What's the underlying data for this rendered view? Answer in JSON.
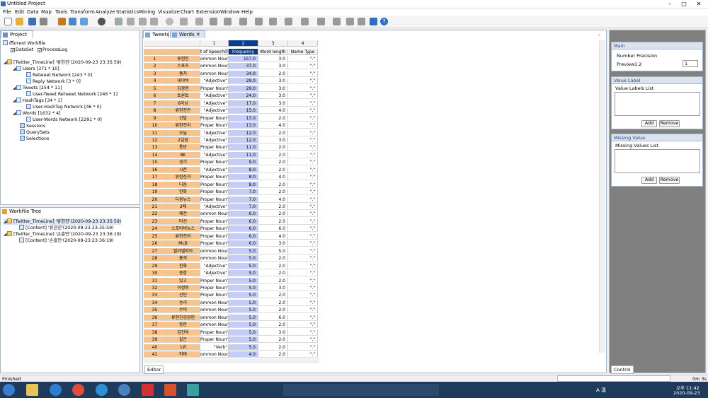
{
  "window": {
    "title": "Untitled Project"
  },
  "menu": [
    "File",
    "Edit",
    "Data",
    "Map",
    "Tools",
    "Transform",
    "Analyze",
    "Statistics",
    "Mining",
    "Visualize",
    "Chart",
    "Extension",
    "Window",
    "Help"
  ],
  "project_panel": {
    "tab": "Project",
    "current_workfile": "Current Workfile",
    "dataset_label": "DataSet",
    "processlog_label": "ProcessLog",
    "tree": [
      "[Twitter_TimeLine] '류현진'(2020-09-23 23:35:59)",
      "Users [371 * 10]",
      "Retweet Network [243 * 0]",
      "Reply Network [3 * 0]",
      "Tweets [254 * 11]",
      "User-Tweet Retweet Network [246 * 1]",
      "HashTags [34 * 1]",
      "User-HashTag Network [46 * 0]",
      "Words [1632 * 4]",
      "User-Words Network [2291 * 0]",
      "Sessions",
      "QuerySets",
      "Selections"
    ]
  },
  "workfile_tree": {
    "tab": "Workfile Tree",
    "items": [
      "[Twitter_TimeLine] '류현진'(2020-09-23 23:35:59)",
      "[Content] '류현진'(2020-09-23 23:35:59)",
      "[Twitter_TimeLine] '손흥민'(2020-09-23 23:36:19)",
      "[Content] '손흥민'(2020-09-23 23:36:19)"
    ]
  },
  "editor": {
    "tabs": [
      "Tweets",
      "Words"
    ],
    "footer": "Editor",
    "col_numbers": [
      "1",
      "2",
      "3",
      "4"
    ],
    "col_headers": [
      "t of Speech(P",
      "Frequency",
      "Word length",
      "Name Type"
    ],
    "rows": [
      [
        "1",
        "류현진",
        "ommon Noun\"",
        "157.0",
        "3.0",
        "\".\""
      ],
      [
        "2",
        "스포츠",
        "ommon Noun\"",
        "37.0",
        "3.0",
        "\".\""
      ],
      [
        "3",
        "홈처",
        "ommon Noun\"",
        "34.0",
        "2.0",
        "\".\""
      ],
      [
        "4",
        "내야비",
        "\"Adjective\"",
        "29.0",
        "3.0",
        "\".\""
      ],
      [
        "5",
        "김광현",
        "Proper Noun\"",
        "29.0",
        "3.0",
        "\".\""
      ],
      [
        "6",
        "토론토",
        "\"Adjective\"",
        "24.0",
        "3.0",
        "\".\""
      ],
      [
        "7",
        "6이닝",
        "\"Adjective\"",
        "17.0",
        "3.0",
        "\".\""
      ],
      [
        "8",
        "류현진은",
        "\"Adjective\"",
        "15.0",
        "4.0",
        "\".\""
      ],
      [
        "9",
        "선발",
        "Proper Noun\"",
        "13.0",
        "2.0",
        "\".\""
      ],
      [
        "10",
        "류현진이",
        "Proper Noun\"",
        "13.0",
        "4.0",
        "\".\""
      ],
      [
        "11",
        "오늘",
        "\"Adjective\"",
        "12.0",
        "2.0",
        "\".\""
      ],
      [
        "12",
        "2실점",
        "\"Adjective\"",
        "12.0",
        "3.0",
        "\".\""
      ],
      [
        "13",
        "통반",
        "Proper Noun\"",
        "11.0",
        "2.0",
        "\".\""
      ],
      [
        "14",
        "8K",
        "\"Adjective\"",
        "11.0",
        "2.0",
        "\".\""
      ],
      [
        "15",
        "경기",
        "Proper Noun\"",
        "9.0",
        "2.0",
        "\".\""
      ],
      [
        "16",
        "시즌",
        "\"Adjective\"",
        "8.0",
        "2.0",
        "\".\""
      ],
      [
        "17",
        "류현진과",
        "Proper Noun\"",
        "8.0",
        "4.0",
        "\".\""
      ],
      [
        "18",
        "다음",
        "Proper Noun\"",
        "8.0",
        "2.0",
        "\".\""
      ],
      [
        "19",
        "한화",
        "Proper Noun\"",
        "7.0",
        "2.0",
        "\".\""
      ],
      [
        "20",
        "다음뉴스",
        "Proper Noun\"",
        "7.0",
        "4.0",
        "\".\""
      ],
      [
        "21",
        "2패",
        "\"Adjective\"",
        "7.0",
        "2.0",
        "\".\""
      ],
      [
        "22",
        "패전",
        "ommon Noun\"",
        "6.0",
        "2.0",
        "\".\""
      ],
      [
        "23",
        "타선",
        "Proper Noun\"",
        "6.0",
        "2.0",
        "\".\""
      ],
      [
        "24",
        "스포티비뉴스",
        "Proper Noun\"",
        "6.0",
        "6.0",
        "\".\""
      ],
      [
        "25",
        "류현진의",
        "Proper Noun\"",
        "6.0",
        "4.0",
        "\".\""
      ],
      [
        "26",
        "MLB",
        "Proper Noun\"",
        "6.0",
        "3.0",
        "\".\""
      ],
      [
        "27",
        "필라델피아",
        "ommon Noun\"",
        "5.0",
        "5.0",
        "\".\""
      ],
      [
        "28",
        "홈격",
        "ommon Noun\"",
        "5.0",
        "2.0",
        "\".\""
      ],
      [
        "29",
        "진화",
        "\"Adjective\"",
        "5.0",
        "2.0",
        "\".\""
      ],
      [
        "30",
        "종합",
        "\"Adjective\"",
        "5.0",
        "2.0",
        "\".\""
      ],
      [
        "31",
        "있고",
        "Proper Noun\"",
        "5.0",
        "2.0",
        "\".\""
      ],
      [
        "32",
        "이정후",
        "Proper Noun\"",
        "5.0",
        "3.0",
        "\".\""
      ],
      [
        "33",
        "선인",
        "Proper Noun\"",
        "5.0",
        "2.0",
        "\".\""
      ],
      [
        "34",
        "승리",
        "ommon Noun\"",
        "5.0",
        "2.0",
        "\".\""
      ],
      [
        "35",
        "수비",
        "ommon Noun\"",
        "5.0",
        "2.0",
        "\".\""
      ],
      [
        "36",
        "류현진김광현",
        "ommon Noun\"",
        "5.0",
        "6.0",
        "\".\""
      ],
      [
        "37",
        "동판",
        "ommon Noun\"",
        "5.0",
        "2.0",
        "\".\""
      ],
      [
        "38",
        "김진욱",
        "Proper Noun\"",
        "5.0",
        "3.0",
        "\".\""
      ],
      [
        "39",
        "같은",
        "Proper Noun\"",
        "5.0",
        "2.0",
        "\".\""
      ],
      [
        "40",
        "1위",
        "\"Verb\"",
        "5.0",
        "2.0",
        "\".\""
      ],
      [
        "41",
        "하며",
        "ommon Noun\"",
        "4.0",
        "2.0",
        "\".\""
      ]
    ]
  },
  "control": {
    "footer": "Control",
    "main": {
      "title": "Main",
      "label": "Number Precision",
      "preview_label": "Preview",
      "preview_value": "1.2",
      "spin_value": "1"
    },
    "value_label": {
      "title": "Value Label",
      "list_label": "Value Labels List",
      "add": "Add",
      "remove": "Remove"
    },
    "missing_value": {
      "title": "Missing Value",
      "list_label": "Missing Values List",
      "add": "Add",
      "remove": "Remove"
    }
  },
  "status": {
    "left": "Finished",
    "right": "0m 3s"
  },
  "taskbar": {
    "time": "오후 11:42",
    "date": "2020-09-23",
    "ime": "A 漢"
  },
  "colors": {
    "row_header": "#f6c58e",
    "selected_col": "#c3cdf5",
    "selected_header": "#0a3e8c",
    "taskbar": "#1f3b5c"
  }
}
